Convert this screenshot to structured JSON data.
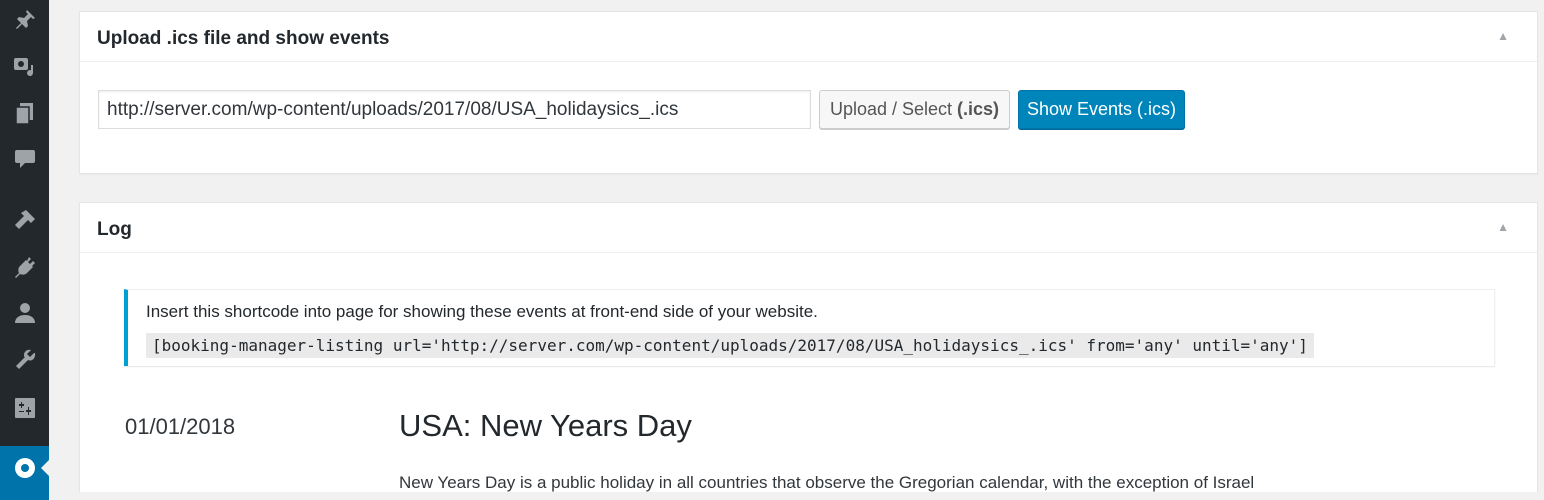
{
  "sidebar": {
    "icons": [
      "pin-icon",
      "media-icon",
      "pages-icon",
      "comments-icon",
      "appearance-icon",
      "plugins-icon",
      "users-icon",
      "tools-icon",
      "settings-icon",
      "booking-manager-icon"
    ]
  },
  "upload_panel": {
    "title": "Upload .ics file and show events",
    "toggle": "▲",
    "url_value": "http://server.com/wp-content/uploads/2017/08/USA_holidaysics_.ics",
    "upload_label": "Upload / Select",
    "upload_ext": "(.ics)",
    "show_label": "Show Events (.ics)"
  },
  "log_panel": {
    "title": "Log",
    "toggle": "▲",
    "notice_text": "Insert this shortcode into page for showing these events at front-end side of your website.",
    "shortcode": "[booking-manager-listing url='http://server.com/wp-content/uploads/2017/08/USA_holidaysics_.ics' from='any' until='any']",
    "event": {
      "date": "01/01/2018",
      "title": "USA: New Years Day",
      "description": "New Years Day is a public holiday in all countries that observe the Gregorian calendar, with the exception of Israel"
    }
  },
  "colors": {
    "sidebar_bg": "#23282d",
    "accent": "#0073aa",
    "primary_button": "#0085ba",
    "notice_border": "#00a0d2"
  }
}
